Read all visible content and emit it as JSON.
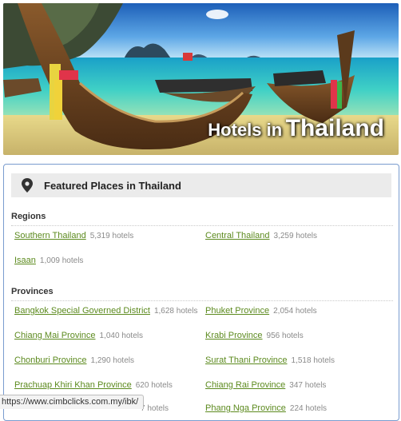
{
  "hero": {
    "title_prefix": "Hotels in",
    "title_country": "Thailand"
  },
  "panel": {
    "title": "Featured Places in Thailand",
    "icon": "map-pin-icon"
  },
  "regions": {
    "heading": "Regions",
    "items": [
      {
        "name": "Southern Thailand",
        "count": "5,319 hotels"
      },
      {
        "name": "Central Thailand",
        "count": "3,259 hotels"
      },
      {
        "name": "Isaan",
        "count": "1,009 hotels"
      }
    ]
  },
  "provinces": {
    "heading": "Provinces",
    "items": [
      {
        "name": "Bangkok Special Governed District",
        "count": "1,628 hotels"
      },
      {
        "name": "Phuket Province",
        "count": "2,054 hotels"
      },
      {
        "name": "Chiang Mai Province",
        "count": "1,040 hotels"
      },
      {
        "name": "Krabi Province",
        "count": "956 hotels"
      },
      {
        "name": "Chonburi Province",
        "count": "1,290 hotels"
      },
      {
        "name": "Surat Thani Province",
        "count": "1,518 hotels"
      },
      {
        "name": "Prachuap Khiri Khan Province",
        "count": "620 hotels"
      },
      {
        "name": "Chiang Rai Province",
        "count": "347 hotels"
      },
      {
        "name": "",
        "count": "7 hotels"
      },
      {
        "name": "Phang Nga Province",
        "count": "224 hotels"
      }
    ]
  },
  "status_bar": {
    "url": "https://www.cimbclicks.com.my/ibk/"
  },
  "colors": {
    "link": "#5c8a1e",
    "panel_border": "#7a9ccf",
    "header_bg": "#ebebeb"
  }
}
